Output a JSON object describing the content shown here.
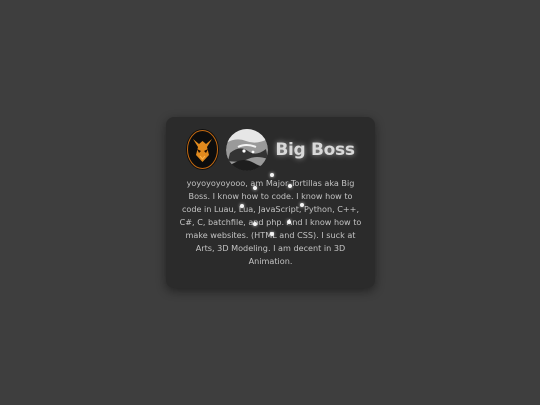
{
  "profile": {
    "name": "Big Boss",
    "bio": "yoyoyoyoyooo, am Major Tortillas aka Big Boss. I know how to code. I know how to code in Luau, Lua, JavaScript, Python, C++, C#, C, batchfile, and php. And I know how to make websites. (HTML and CSS). I suck at Arts, 3D Modeling. I am decent in 3D Animation.",
    "avatars": [
      "fox-emblem-avatar",
      "snake-portrait-avatar"
    ]
  },
  "colors": {
    "background": "#3e3e3e",
    "card": "#2b2b2b",
    "name_text": "#d9d9d9",
    "bio_text": "#c4c4c4",
    "particle": "#f4f4f4"
  }
}
